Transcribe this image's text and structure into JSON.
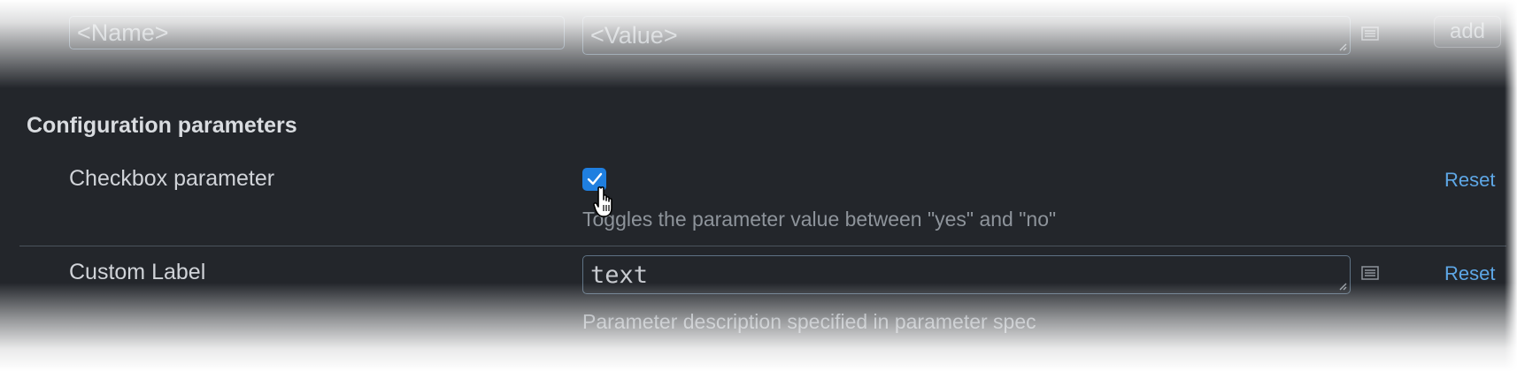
{
  "new_param_row": {
    "name_placeholder": "<Name>",
    "value_placeholder": "<Value>",
    "editor_icon": "list-icon",
    "add_label": "add"
  },
  "section": {
    "title": "Configuration parameters"
  },
  "params": [
    {
      "label": "Checkbox parameter",
      "checked": true,
      "description": "Toggles the parameter value between \"yes\" and \"no\"",
      "reset_label": "Reset"
    },
    {
      "label": "Custom Label",
      "value": "text",
      "editor_icon": "list-icon",
      "description": "Parameter description specified in parameter spec",
      "reset_label": "Reset"
    }
  ],
  "colors": {
    "background": "#23262b",
    "accent": "#1f7fe0",
    "link": "#5ea7e6"
  }
}
